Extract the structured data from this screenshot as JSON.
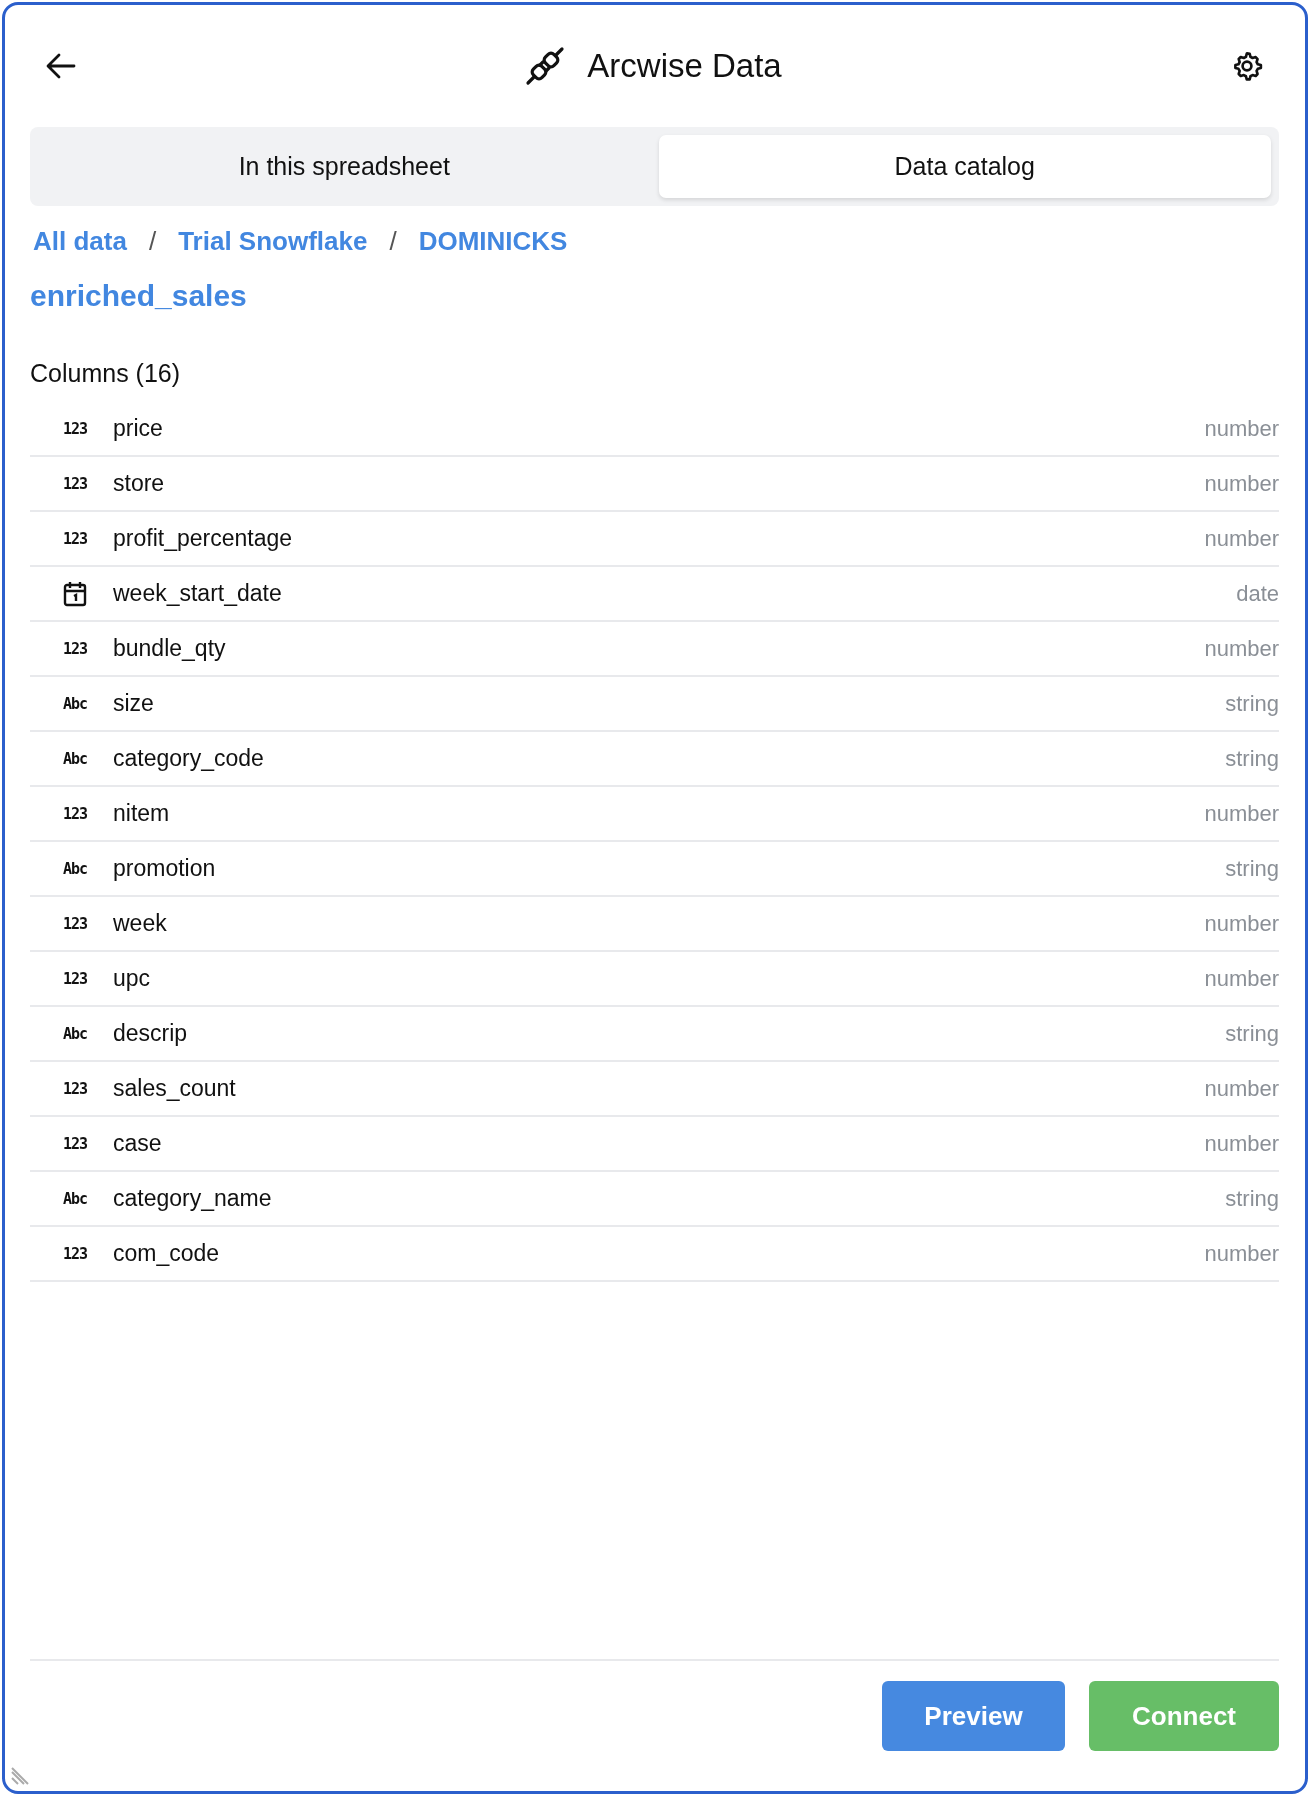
{
  "header": {
    "title": "Arcwise Data"
  },
  "tabs": [
    {
      "label": "In this spreadsheet",
      "selected": false
    },
    {
      "label": "Data catalog",
      "selected": true
    }
  ],
  "breadcrumb": [
    "All data",
    "Trial Snowflake",
    "DOMINICKS"
  ],
  "breadcrumb_separator": "/",
  "table_name": "enriched_sales",
  "columns_heading": "Columns (16)",
  "columns": [
    {
      "kind": "glyph",
      "glyph": "123",
      "name": "price",
      "type": "number"
    },
    {
      "kind": "glyph",
      "glyph": "123",
      "name": "store",
      "type": "number"
    },
    {
      "kind": "glyph",
      "glyph": "123",
      "name": "profit_percentage",
      "type": "number"
    },
    {
      "kind": "calendar",
      "name": "week_start_date",
      "type": "date"
    },
    {
      "kind": "glyph",
      "glyph": "123",
      "name": "bundle_qty",
      "type": "number"
    },
    {
      "kind": "glyph",
      "glyph": "Abc",
      "name": "size",
      "type": "string"
    },
    {
      "kind": "glyph",
      "glyph": "Abc",
      "name": "category_code",
      "type": "string"
    },
    {
      "kind": "glyph",
      "glyph": "123",
      "name": "nitem",
      "type": "number"
    },
    {
      "kind": "glyph",
      "glyph": "Abc",
      "name": "promotion",
      "type": "string"
    },
    {
      "kind": "glyph",
      "glyph": "123",
      "name": "week",
      "type": "number"
    },
    {
      "kind": "glyph",
      "glyph": "123",
      "name": "upc",
      "type": "number"
    },
    {
      "kind": "glyph",
      "glyph": "Abc",
      "name": "descrip",
      "type": "string"
    },
    {
      "kind": "glyph",
      "glyph": "123",
      "name": "sales_count",
      "type": "number"
    },
    {
      "kind": "glyph",
      "glyph": "123",
      "name": "case",
      "type": "number"
    },
    {
      "kind": "glyph",
      "glyph": "Abc",
      "name": "category_name",
      "type": "string"
    },
    {
      "kind": "glyph",
      "glyph": "123",
      "name": "com_code",
      "type": "number"
    }
  ],
  "buttons": [
    {
      "kind": "preview",
      "label": "Preview"
    },
    {
      "kind": "connect",
      "label": "Connect"
    }
  ]
}
